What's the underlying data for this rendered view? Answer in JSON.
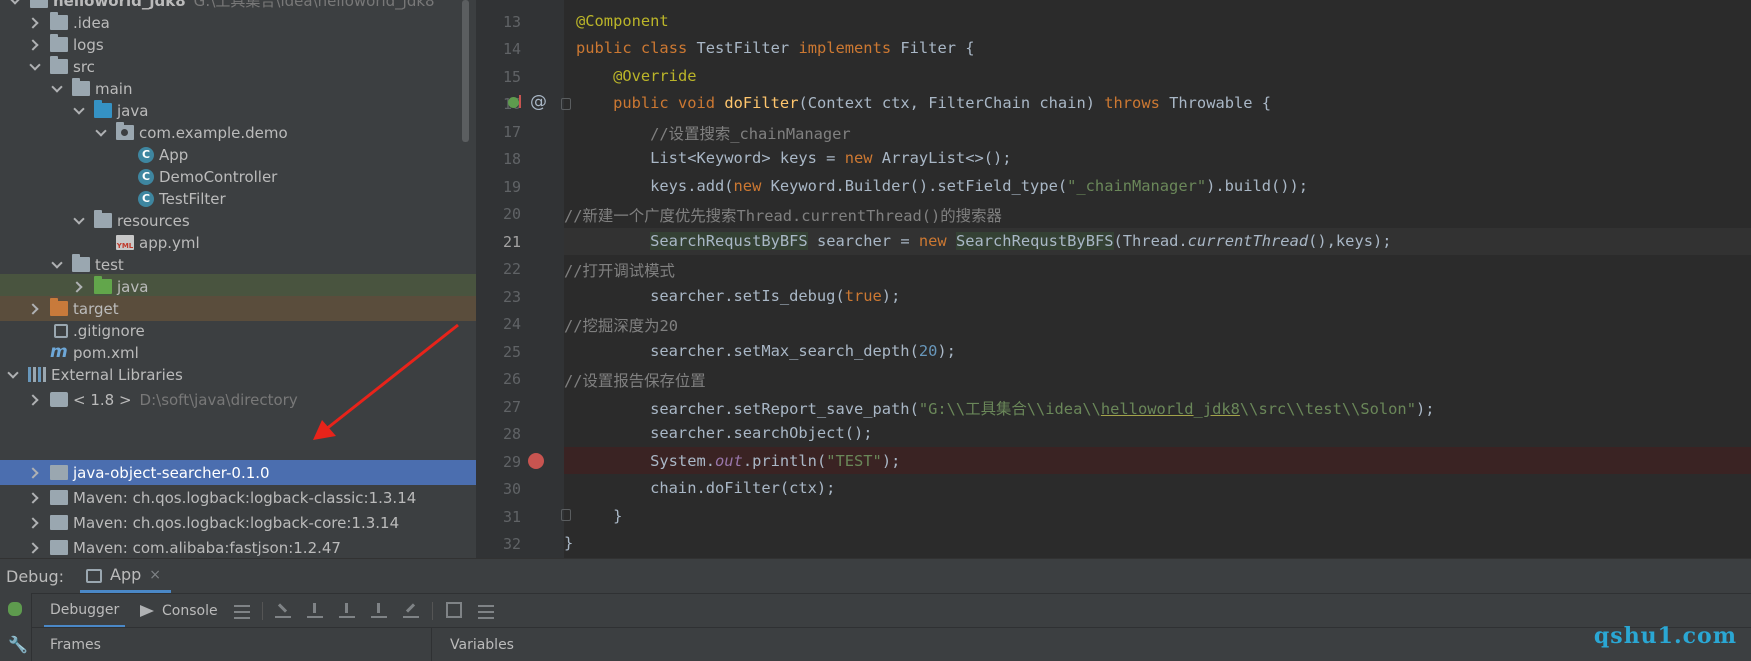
{
  "project_tree": {
    "root": {
      "label": "helloworld_jdk8",
      "path": "G:\\工具集合\\idea\\helloworld_jdk8"
    },
    "items": [
      {
        "label": ".idea"
      },
      {
        "label": "logs"
      },
      {
        "label": "src"
      },
      {
        "label": "main"
      },
      {
        "label": "java"
      },
      {
        "label": "com.example.demo"
      },
      {
        "label": "App"
      },
      {
        "label": "DemoController"
      },
      {
        "label": "TestFilter"
      },
      {
        "label": "resources"
      },
      {
        "label": "app.yml"
      },
      {
        "label": "test"
      },
      {
        "label": "java"
      },
      {
        "label": "target"
      },
      {
        "label": ".gitignore"
      },
      {
        "label": "pom.xml"
      },
      {
        "label": "External Libraries"
      },
      {
        "label": "< 1.8 >",
        "path": "D:\\soft\\java\\directory"
      },
      {
        "label": "java-object-searcher-0.1.0"
      },
      {
        "label": "Maven: ch.qos.logback:logback-classic:1.3.14"
      },
      {
        "label": "Maven: ch.qos.logback:logback-core:1.3.14"
      },
      {
        "label": "Maven: com.alibaba:fastjson:1.2.47"
      }
    ],
    "yml_badge": "YML",
    "class_badge": "C",
    "pom_badge": "m"
  },
  "editor": {
    "line_numbers": [
      "13",
      "14",
      "15",
      "16",
      "17",
      "18",
      "19",
      "20",
      "21",
      "22",
      "23",
      "24",
      "25",
      "26",
      "27",
      "28",
      "29",
      "30",
      "31",
      "32"
    ],
    "current_line": "21",
    "breakpoint_line": "29",
    "at_icon": "@",
    "l13": {
      "a": "@Component"
    },
    "l14": {
      "a": "public",
      "b": " ",
      "c": "class",
      "d": " TestFilter ",
      "e": "implements",
      "f": " Filter {"
    },
    "l15": {
      "a": "    ",
      "b": "@Override"
    },
    "l16": {
      "a": "    ",
      "b": "public",
      "c": " ",
      "d": "void",
      "e": " ",
      "f": "doFilter",
      "g": "(Context ctx, FilterChain chain) ",
      "h": "throws",
      "i": " Throwable {"
    },
    "l17": {
      "a": "        ",
      "b": "//设置搜索_chainManager"
    },
    "l18": {
      "a": "        List<Keyword> keys = ",
      "b": "new",
      "c": " ArrayList<>();"
    },
    "l19": {
      "a": "        keys.add(",
      "b": "new",
      "c": " Keyword.Builder().setField_type(",
      "d": "\"_chainManager\"",
      "e": ").build());"
    },
    "l20": {
      "a": "//新建一个广度优先搜索Thread.currentThread()的搜索器"
    },
    "l21": {
      "a": "        ",
      "b": "SearchRequstByBFS",
      "c": " searcher = ",
      "d": "new",
      "e": " ",
      "f": "SearchRequstByBFS",
      "g": "(Thread.",
      "h": "currentThread",
      "i": "(),keys);"
    },
    "l22": {
      "a": "//打开调试模式"
    },
    "l23": {
      "a": "        searcher.setIs_debug(",
      "b": "true",
      "c": ");"
    },
    "l24": {
      "a": "//挖掘深度为20"
    },
    "l25": {
      "a": "        searcher.setMax_search_depth(",
      "b": "20",
      "c": ");"
    },
    "l26": {
      "a": "//设置报告保存位置"
    },
    "l27": {
      "a": "        searcher.setReport_save_path(",
      "b": "\"G:\\\\工具集合\\\\idea\\\\",
      "c": "helloworld",
      "d": "_",
      "e": "jdk8",
      "f": "\\\\src\\\\test\\\\Solon\"",
      "g": ");"
    },
    "l28": {
      "a": "        searcher.searchObject();"
    },
    "l29": {
      "a": "        System.",
      "b": "out",
      "c": ".println(",
      "d": "\"TEST\"",
      "e": ");"
    },
    "l30": {
      "a": "        chain.doFilter(ctx);"
    },
    "l31": {
      "a": "    }"
    },
    "l32": {
      "a": "}"
    }
  },
  "debug_panel": {
    "label": "Debug:",
    "session_tab": "App",
    "close_glyph": "×",
    "tabs": {
      "debugger": "Debugger",
      "console": "Console"
    },
    "frames_label": "Frames",
    "variables_label": "Variables",
    "wrench_glyph": "🔧"
  },
  "watermark": "qshu1.com",
  "colors": {
    "selection": "#4b6eaf",
    "accent": "#4a88c7",
    "arrow": "#e8231a",
    "watermark": "#2aa7d4"
  }
}
